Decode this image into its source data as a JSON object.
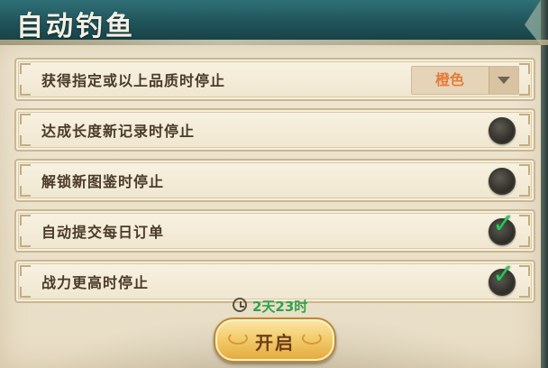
{
  "window": {
    "title": "自动钓鱼"
  },
  "settings": [
    {
      "label": "获得指定或以上品质时停止",
      "control": "dropdown",
      "value": "橙色",
      "value_color": "#e37c38"
    },
    {
      "label": "达成长度新记录时停止",
      "control": "toggle",
      "checked": false
    },
    {
      "label": "解锁新图鉴时停止",
      "control": "toggle",
      "checked": false
    },
    {
      "label": "自动提交每日订单",
      "control": "toggle",
      "checked": true
    },
    {
      "label": "战力更高时停止",
      "control": "toggle",
      "checked": true
    }
  ],
  "timer": {
    "icon": "clock-icon",
    "remaining": "2天23时",
    "color": "#2fa34e"
  },
  "actions": {
    "start_label": "开启"
  },
  "icons": {
    "check": "✓"
  }
}
